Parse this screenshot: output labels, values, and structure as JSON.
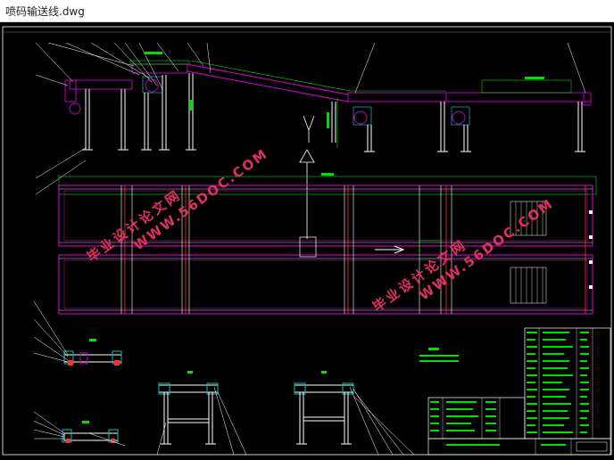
{
  "window": {
    "title": "喷码输送线.dwg"
  },
  "watermarks": [
    {
      "brand": "毕业设计论文网",
      "url": "WWW.56DOC.COM"
    },
    {
      "brand": "毕业设计论文网",
      "url": "WWW.56DOC.COM"
    }
  ],
  "colors": {
    "background": "#000000",
    "frame": "#ffffff",
    "conveyor": "#c000c0",
    "belt": "#00e000",
    "detail": "#00c0c0",
    "hardware": "#ff3030",
    "watermark": "#e03060",
    "table_text": "#00e000"
  }
}
